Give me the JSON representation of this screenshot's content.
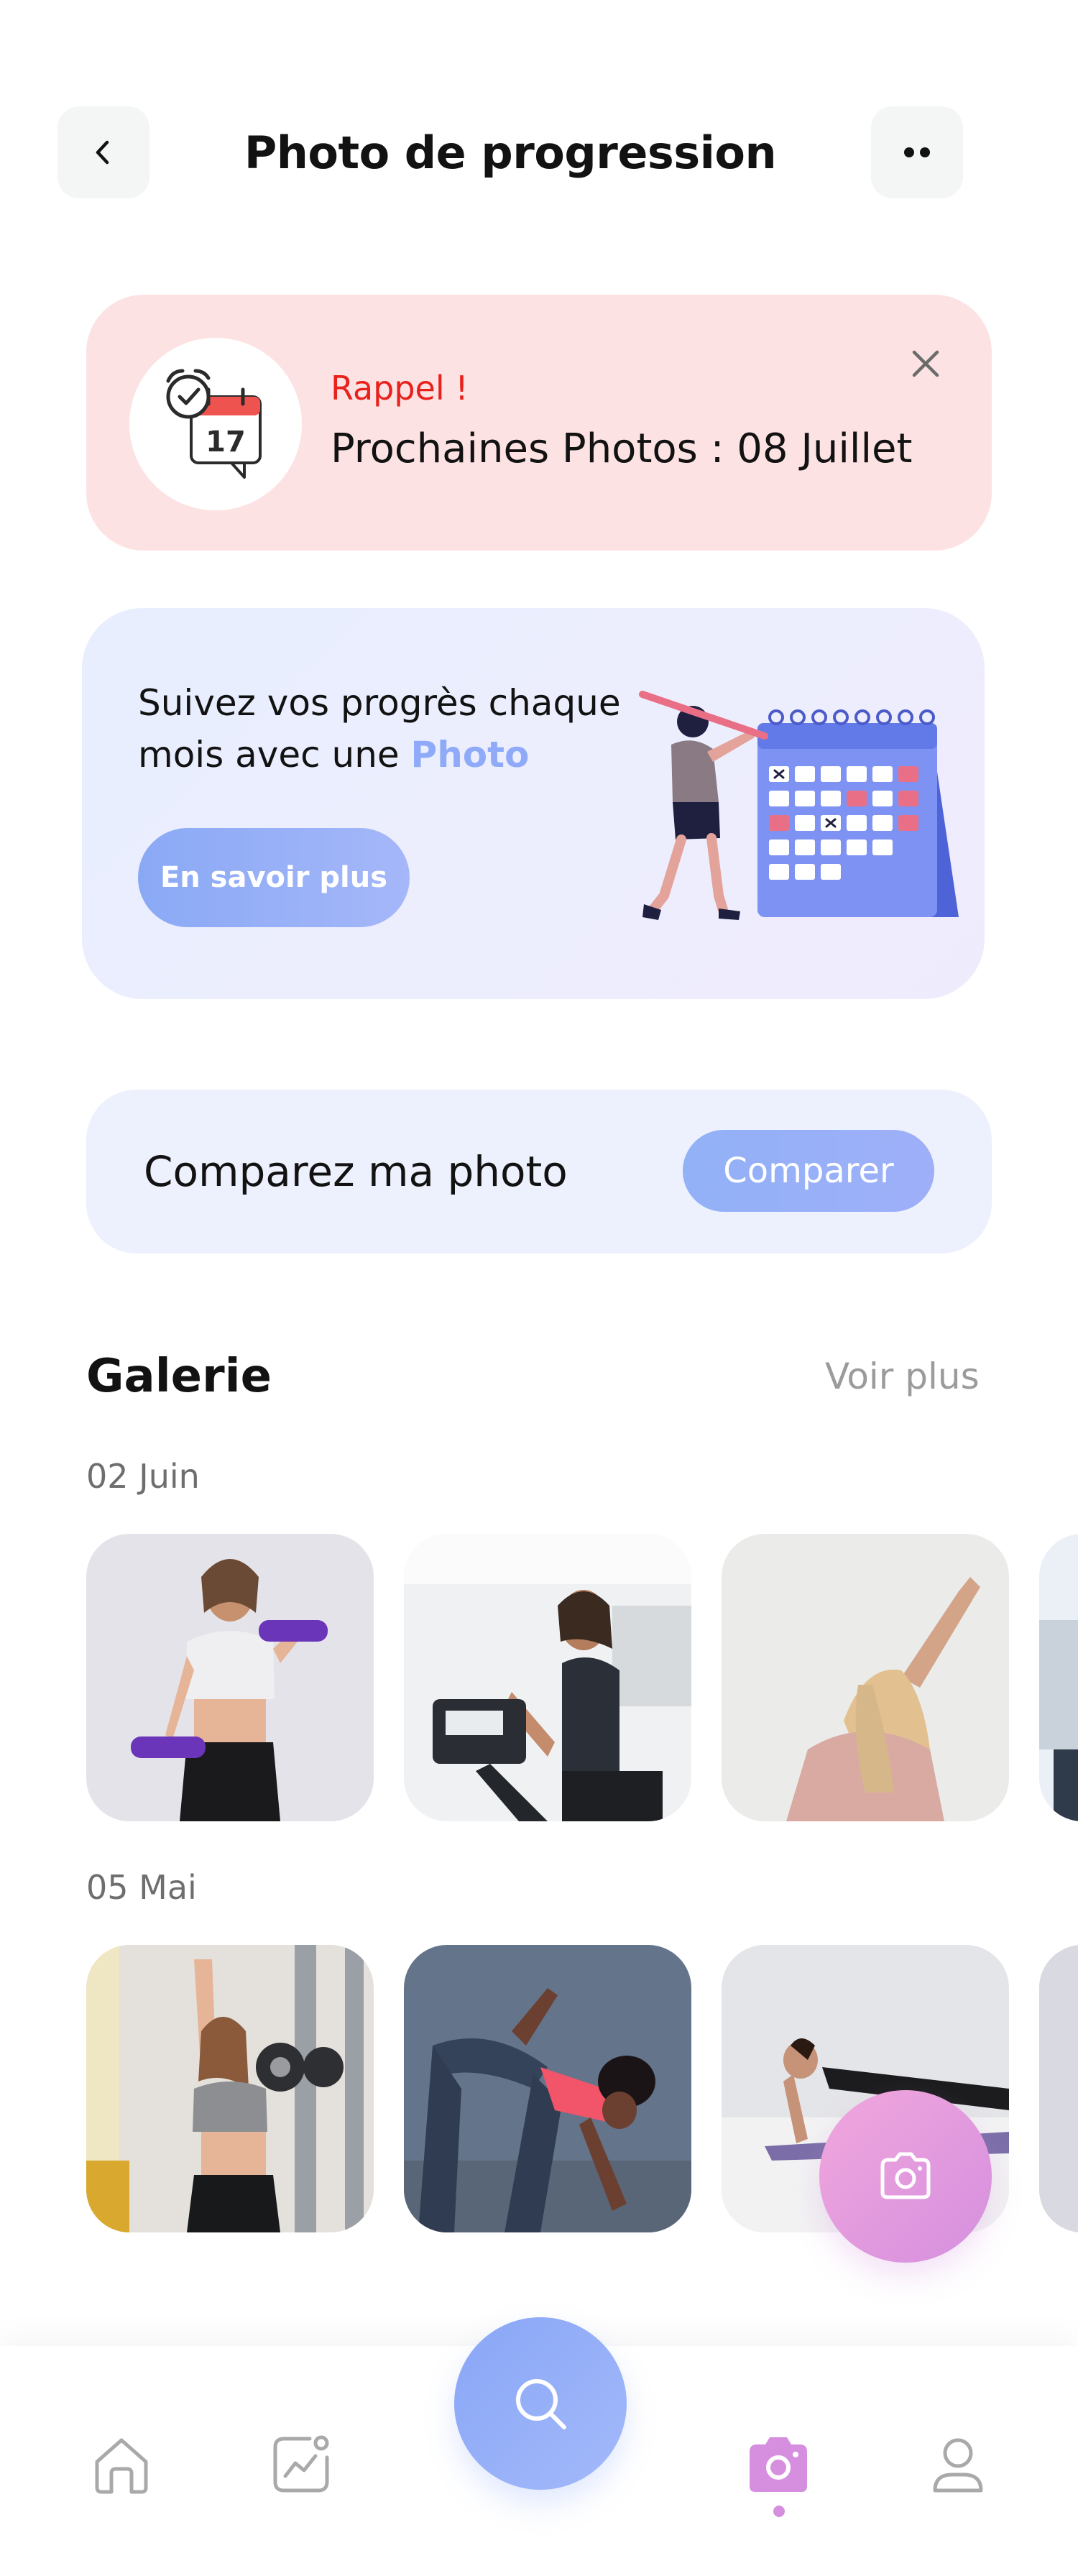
{
  "header": {
    "title": "Photo de progression",
    "back_icon": "chevron-left-icon",
    "more_icon": "more-dots-icon"
  },
  "reminder": {
    "label": "Rappel !",
    "text": "Prochaines Photos : 08 Juillet",
    "calendar_day": "17",
    "close_icon": "close-icon"
  },
  "promo": {
    "text_before": "Suivez vos progrès chaque mois avec une ",
    "text_highlight": "Photo",
    "button_label": "En savoir plus"
  },
  "compare": {
    "label": "Comparez ma photo",
    "button_label": "Comparer"
  },
  "gallery": {
    "title": "Galerie",
    "see_more": "Voir plus",
    "groups": [
      {
        "date": "02 Juin",
        "photos": [
          "woman-dumbbells",
          "woman-exercise-bike",
          "woman-stretching",
          "partial-photo"
        ]
      },
      {
        "date": "05 Mai",
        "photos": [
          "woman-dumbbell-gym",
          "woman-stretch-leg",
          "woman-plank",
          "partial-photo"
        ]
      }
    ]
  },
  "fab": {
    "icon": "camera-icon"
  },
  "nav": {
    "items": [
      "home-icon",
      "chart-icon",
      "search-icon",
      "camera-icon",
      "profile-icon"
    ],
    "active": "camera-icon"
  },
  "colors": {
    "accent_blue": "#8faaf8",
    "reminder_bg": "#fde2e3",
    "reminder_red": "#e8211d",
    "accent_pink": "#d58fde"
  }
}
